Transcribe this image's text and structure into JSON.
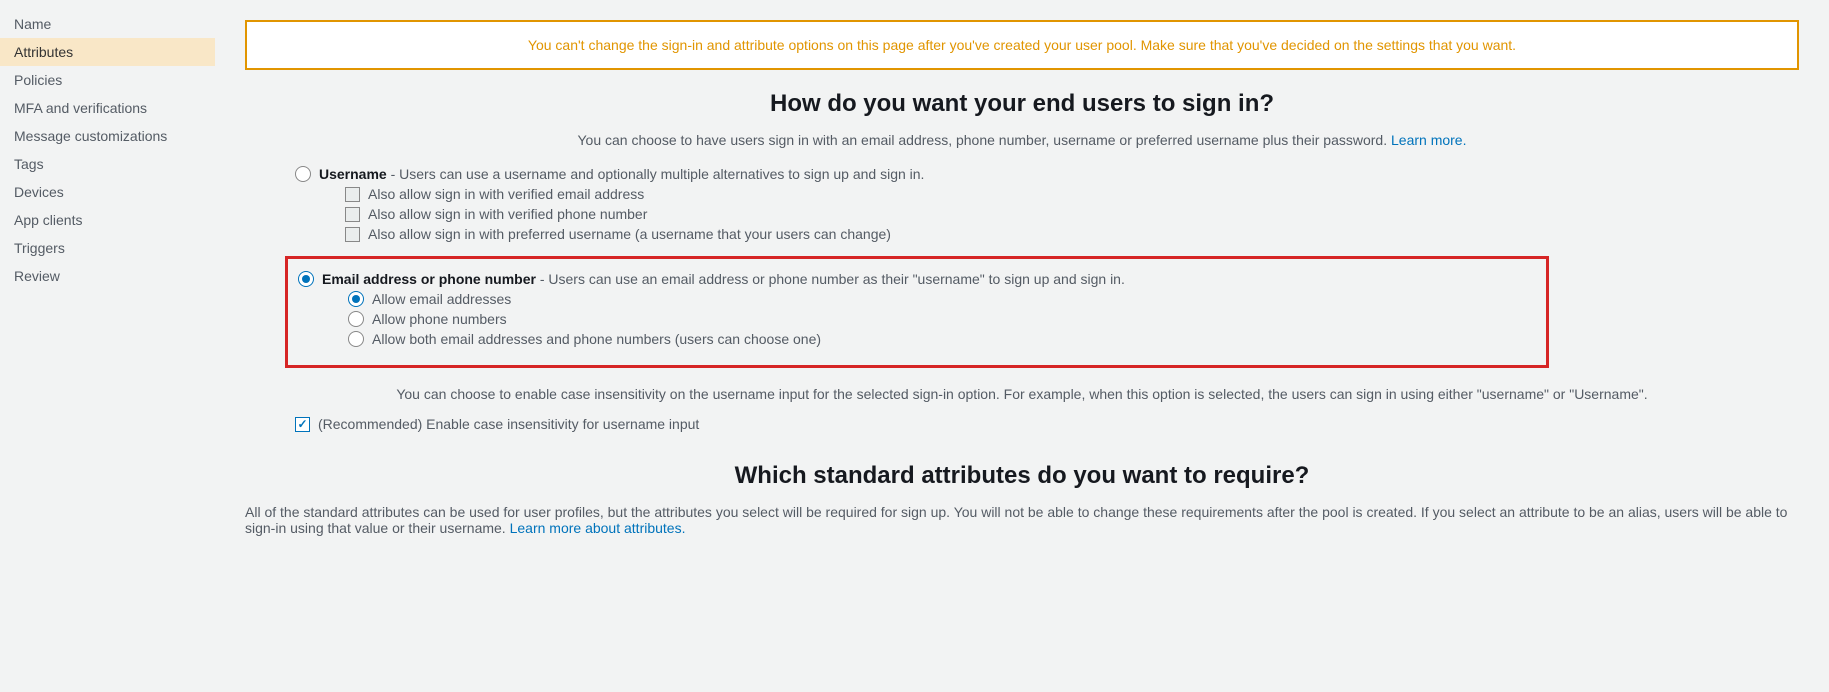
{
  "sidebar": {
    "items": [
      {
        "label": "Name",
        "active": false
      },
      {
        "label": "Attributes",
        "active": true
      },
      {
        "label": "Policies",
        "active": false
      },
      {
        "label": "MFA and verifications",
        "active": false
      },
      {
        "label": "Message customizations",
        "active": false
      },
      {
        "label": "Tags",
        "active": false
      },
      {
        "label": "Devices",
        "active": false
      },
      {
        "label": "App clients",
        "active": false
      },
      {
        "label": "Triggers",
        "active": false
      },
      {
        "label": "Review",
        "active": false
      }
    ]
  },
  "warning": "You can't change the sign-in and attribute options on this page after you've created your user pool. Make sure that you've decided on the settings that you want.",
  "signin": {
    "heading": "How do you want your end users to sign in?",
    "subtext": "You can choose to have users sign in with an email address, phone number, username or preferred username plus their password. ",
    "learn_more": "Learn more.",
    "option_username": {
      "title": "Username",
      "desc": " - Users can use a username and optionally multiple alternatives to sign up and sign in.",
      "sub": [
        "Also allow sign in with verified email address",
        "Also allow sign in with verified phone number",
        "Also allow sign in with preferred username (a username that your users can change)"
      ]
    },
    "option_email": {
      "title": "Email address or phone number",
      "desc": " - Users can use an email address or phone number as their \"username\" to sign up and sign in.",
      "sub": [
        "Allow email addresses",
        "Allow phone numbers",
        "Allow both email addresses and phone numbers (users can choose one)"
      ]
    },
    "case_text": "You can choose to enable case insensitivity on the username input for the selected sign-in option. For example, when this option is selected, the users can sign in using either \"username\" or \"Username\".",
    "case_checkbox": "(Recommended) Enable case insensitivity for username input"
  },
  "attributes": {
    "heading": "Which standard attributes do you want to require?",
    "desc": "All of the standard attributes can be used for user profiles, but the attributes you select will be required for sign up. You will not be able to change these requirements after the pool is created. If you select an attribute to be an alias, users will be able to sign-in using that value or their username. ",
    "learn_more": "Learn more about attributes."
  }
}
